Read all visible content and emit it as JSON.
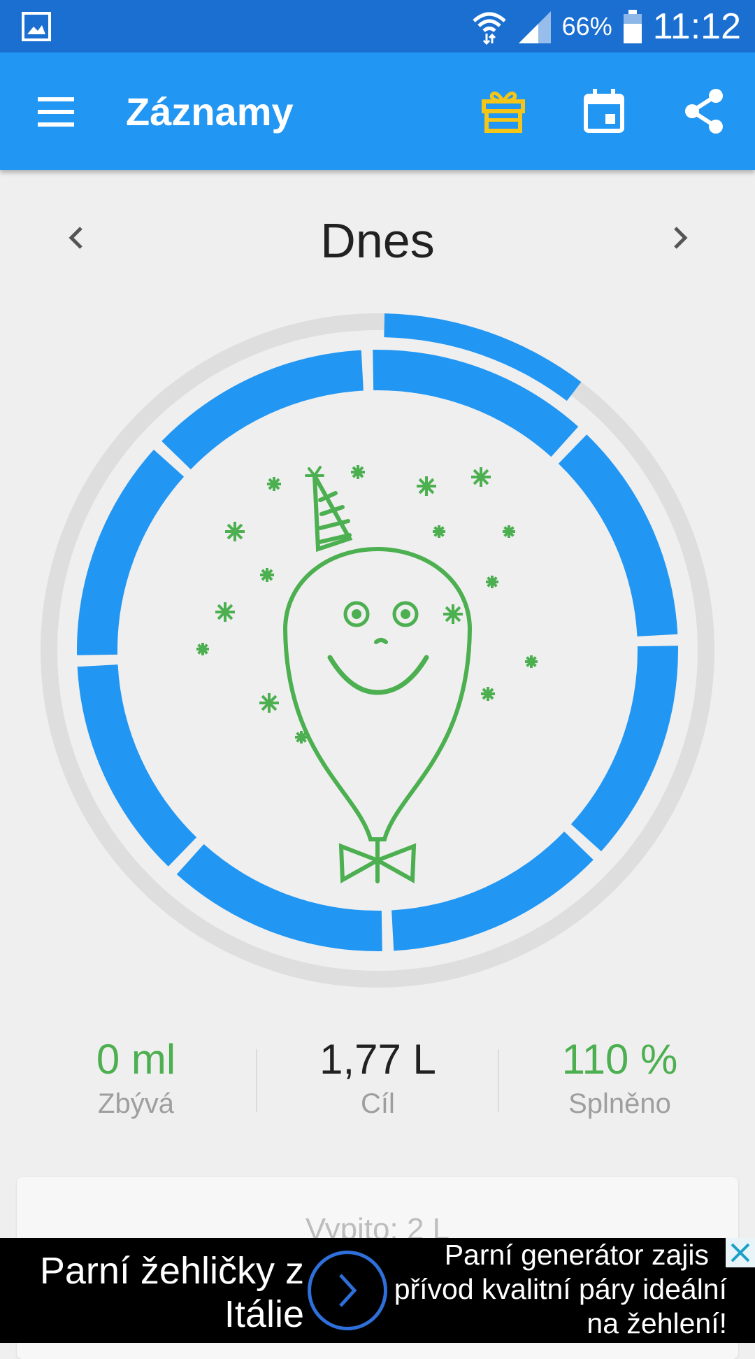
{
  "status_bar": {
    "battery": "66%",
    "time": "11:12"
  },
  "app_bar": {
    "title": "Záznamy",
    "icons": [
      "menu-icon",
      "gift-icon",
      "calendar-icon",
      "share-icon"
    ],
    "gift_color": "#f5c518"
  },
  "day_nav": {
    "label": "Dnes"
  },
  "progress": {
    "fraction": 1.1,
    "segments": 8,
    "colors": {
      "fill": "#2196f3",
      "track": "#dedede",
      "illustration": "#4caf50"
    }
  },
  "stats": {
    "remaining": {
      "value": "0 ml",
      "label": "Zbývá"
    },
    "goal": {
      "value": "1,77 L",
      "label": "Cíl"
    },
    "done": {
      "value": "110 %",
      "label": "Splněno"
    }
  },
  "card": {
    "drunk": "Vypito: 2 L"
  },
  "ad": {
    "headline_line1": "Parní žehličky z",
    "headline_line2": "Itálie",
    "body_line1": "Parní generátor zajis",
    "body_line2": "přívod kvalitní páry ideální",
    "body_line3": "na žehlení!"
  }
}
